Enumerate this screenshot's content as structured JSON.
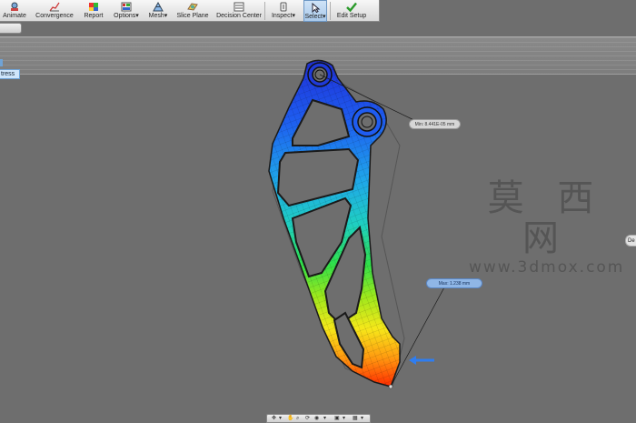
{
  "toolbar": {
    "items": [
      {
        "label": "Animate",
        "icon": "animate-icon"
      },
      {
        "label": "Convergence",
        "icon": "convergence-icon"
      },
      {
        "label": "Report",
        "icon": "report-icon"
      },
      {
        "label": "Options",
        "icon": "options-icon"
      },
      {
        "label": "Mesh",
        "icon": "mesh-icon"
      },
      {
        "label": "Slice Plane",
        "icon": "slice-plane-icon"
      },
      {
        "label": "Decision Center",
        "icon": "decision-center-icon"
      },
      {
        "label": "Inspect",
        "icon": "inspect-icon"
      },
      {
        "label": "Select",
        "icon": "select-cursor-icon"
      },
      {
        "label": "Edit Setup",
        "icon": "check-icon"
      }
    ]
  },
  "left_panel": {
    "stress_tab": "tress"
  },
  "probes": {
    "min": "Min: 8.441E-05 mm",
    "max": "Max: 1.238 mm"
  },
  "right_tab": {
    "label": "De"
  },
  "watermark": {
    "cn": "莫 西 网",
    "url": "www.3dmox.com"
  },
  "colors": {
    "accent": "#4f88d6",
    "contour_min": "#1a3cff",
    "contour_max": "#ff2a00",
    "viewport_bg": "#6e6e6e"
  }
}
